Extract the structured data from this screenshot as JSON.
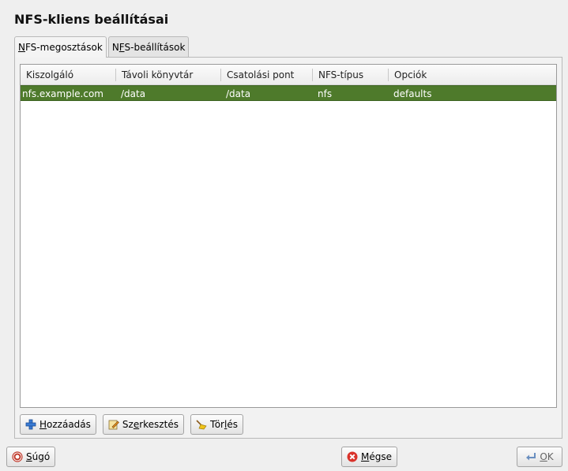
{
  "window": {
    "title": "NFS-kliens beállításai"
  },
  "tabs": [
    {
      "pre": "",
      "accel": "N",
      "post": "FS-megosztások"
    },
    {
      "pre": "N",
      "accel": "F",
      "post": "S-beállítások"
    }
  ],
  "table": {
    "headers": [
      "Kiszolgáló",
      "Távoli könyvtár",
      "Csatolási pont",
      "NFS-típus",
      "Opciók"
    ],
    "rows": [
      [
        "nfs.example.com",
        "/data",
        "/data",
        "nfs",
        "defaults"
      ]
    ]
  },
  "buttons": {
    "add": {
      "pre": "",
      "accel": "H",
      "post": "ozzáadás"
    },
    "edit": {
      "pre": "Sz",
      "accel": "e",
      "post": "rkesztés"
    },
    "delete": {
      "pre": "Tör",
      "accel": "l",
      "post": "és"
    },
    "help": {
      "pre": "",
      "accel": "S",
      "post": "úgó"
    },
    "cancel": {
      "pre": "",
      "accel": "M",
      "post": "égse"
    },
    "ok": {
      "pre": "",
      "accel": "O",
      "post": "K"
    }
  },
  "colors": {
    "selection": "#4e7a2b",
    "add_icon": "#3a7bd5",
    "cancel_icon": "#d9322a",
    "help_icon": "#c0392b"
  }
}
